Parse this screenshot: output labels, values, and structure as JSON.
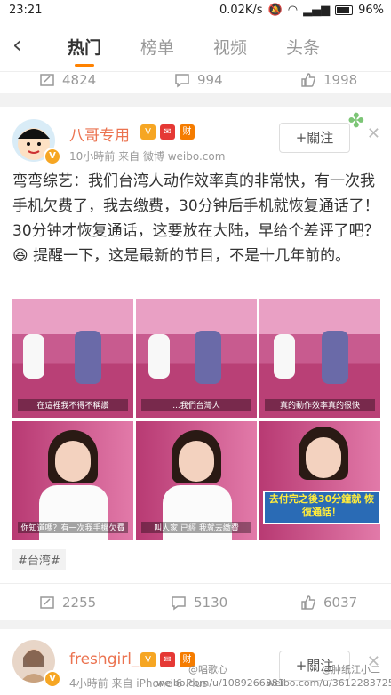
{
  "status": {
    "time": "23:21",
    "speed": "0.02K/s",
    "battery": "96%"
  },
  "nav": {
    "tabs": [
      "热门",
      "榜单",
      "视频",
      "头条"
    ],
    "active": 0
  },
  "prev": {
    "repost": "4824",
    "comment": "994",
    "like": "1998"
  },
  "post": {
    "user": "八哥专用",
    "meta": "10小時前  来自 微博 weibo.com",
    "follow": "+關注",
    "text_a": "弯弯综艺：我们台湾人动作效率真的非常快，有一次我手机欠费了，我去缴费，30分钟后手机就恢复通话了！30分钟才恢复通话，这要放在大陆，早给个差评了吧？",
    "emoji": "😆",
    "text_b": " 提醒一下，这是最新的节目，不是十几年前的。",
    "images": [
      {
        "caption": "在這裡我不得不稱讚"
      },
      {
        "caption": "...我們台灣人"
      },
      {
        "caption": "真的動作效率真的很快"
      },
      {
        "caption": "你知道嗎？有一次我手機欠費"
      },
      {
        "caption": "叫人家 已經 我就去繳費"
      },
      {
        "caption": "去付完之後30分鐘就 恢復通話！"
      }
    ],
    "tag": "#台湾#",
    "repost": "2255",
    "comment": "5130",
    "like": "6037"
  },
  "next": {
    "user": "freshgirl_",
    "meta": "4小時前  来自 iPhone 6 Plus",
    "follow": "+關注"
  },
  "watermarks": [
    "@唱歌心",
    "weibo.com/u/1089266381",
    "@肿纸江小二",
    "weibo.com/u/3612283725"
  ]
}
